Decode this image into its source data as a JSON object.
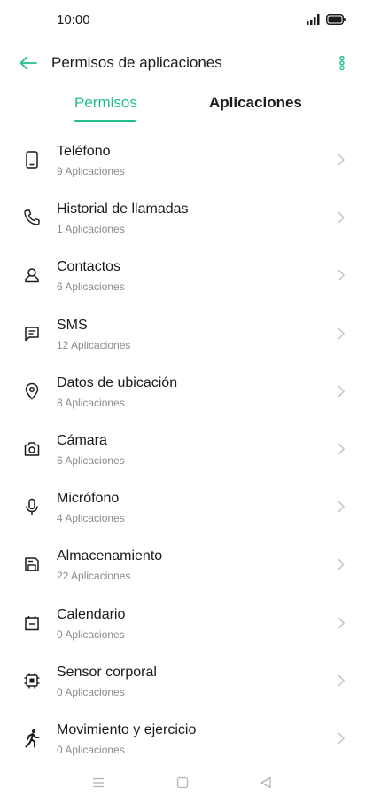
{
  "status_bar": {
    "time": "10:00"
  },
  "header": {
    "title": "Permisos de aplicaciones"
  },
  "tabs": [
    {
      "label": "Permisos",
      "active": true
    },
    {
      "label": "Aplicaciones",
      "active": false
    }
  ],
  "colors": {
    "accent": "#1fbf8f",
    "text": "#1a1a1a",
    "subtext": "#8a8a8a"
  },
  "permissions": [
    {
      "title": "Teléfono",
      "subtitle": "9 Aplicaciones",
      "icon": "phone-icon"
    },
    {
      "title": "Historial de llamadas",
      "subtitle": "1 Aplicaciones",
      "icon": "call-log-icon"
    },
    {
      "title": "Contactos",
      "subtitle": "6 Aplicaciones",
      "icon": "contacts-icon"
    },
    {
      "title": "SMS",
      "subtitle": "12 Aplicaciones",
      "icon": "sms-icon"
    },
    {
      "title": "Datos de ubicación",
      "subtitle": "8 Aplicaciones",
      "icon": "location-icon"
    },
    {
      "title": "Cámara",
      "subtitle": "6 Aplicaciones",
      "icon": "camera-icon"
    },
    {
      "title": "Micrófono",
      "subtitle": "4 Aplicaciones",
      "icon": "microphone-icon"
    },
    {
      "title": "Almacenamiento",
      "subtitle": "22 Aplicaciones",
      "icon": "storage-icon"
    },
    {
      "title": "Calendario",
      "subtitle": "0 Aplicaciones",
      "icon": "calendar-icon"
    },
    {
      "title": "Sensor corporal",
      "subtitle": "0 Aplicaciones",
      "icon": "body-sensor-icon"
    },
    {
      "title": "Movimiento y ejercicio",
      "subtitle": "0 Aplicaciones",
      "icon": "activity-icon"
    }
  ]
}
